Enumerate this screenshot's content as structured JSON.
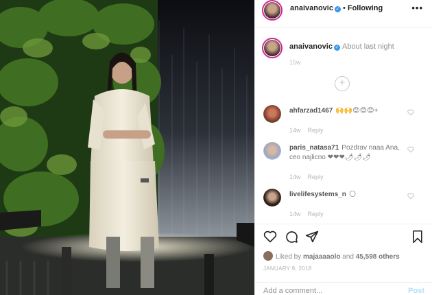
{
  "post": {
    "username": "anaivanovic",
    "verified_mark": "✓",
    "separator": "•",
    "follow_status": "Following",
    "more_icon": "•••",
    "caption": "About last night",
    "caption_time": "15w"
  },
  "comments": [
    {
      "user": "ahfarzad1467",
      "text": "🙌🙌😊😊😊+",
      "time": "14w",
      "reply": "Reply",
      "avatar_color": "#8a3b2b",
      "text2": ""
    },
    {
      "user": "paris_natasa71",
      "text": "Pozdrav naaa Ana,",
      "text2": "ceo najlicno ❤❤❤🌶🌶🌶",
      "time": "14w",
      "reply": "Reply",
      "avatar_color": "#9aa6c2"
    },
    {
      "user": "livelifesystems_n",
      "text": "🌕",
      "time": "14w",
      "reply": "Reply",
      "avatar_color": "#2b1d18",
      "text2": ""
    }
  ],
  "load_more_icon": "+",
  "actions": {
    "liked_by_prefix": "Liked by",
    "liked_by_user": "majaaaaolo",
    "liked_by_joiner": "and",
    "liked_count": "45,598 others",
    "date": "JANUARY 9, 2018",
    "add_comment_placeholder": "Add a comment...",
    "post_label": "Post"
  },
  "colors": {
    "verified": "#3897f0",
    "link_blue": "#b2dffc",
    "story_ring": "#d6249f"
  }
}
